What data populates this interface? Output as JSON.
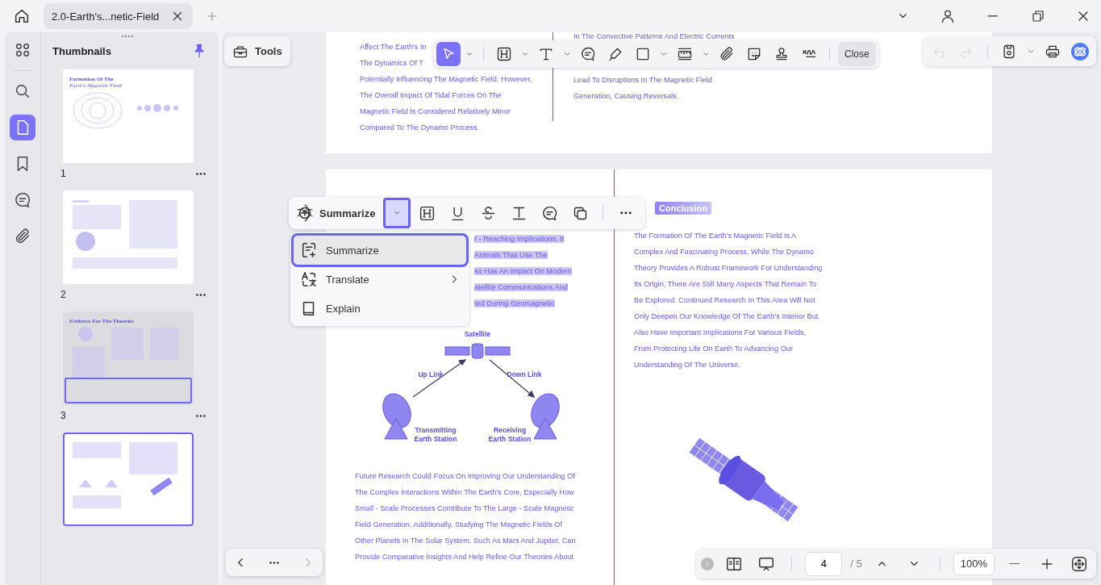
{
  "tab_bar": {
    "tabs": [
      {
        "title": "2.0-Earth's...netic-Field",
        "selected": true
      }
    ]
  },
  "sidebar": {
    "rail": [
      {
        "kind": "apps",
        "selected": false
      },
      {
        "kind": "search",
        "selected": false
      },
      {
        "kind": "page",
        "selected": true
      },
      {
        "kind": "bookmark",
        "selected": false
      },
      {
        "kind": "comment",
        "selected": false
      },
      {
        "kind": "attachment",
        "selected": false
      }
    ],
    "panel": {
      "title": "Thumbnails",
      "pinned": true
    },
    "thumbnails": [
      {
        "number": "1",
        "kind": "title",
        "title": "Formation Of The",
        "subtitle": "Earth's Magnetic Field",
        "selected": false,
        "in_view": false
      },
      {
        "number": "2",
        "kind": "columns",
        "selected": false,
        "in_view": false
      },
      {
        "number": "3",
        "kind": "evidence",
        "title": "*Evidence* For The Theories",
        "selected": false,
        "in_view": true
      },
      {
        "kind": "diagram",
        "selected": true,
        "in_view": false
      }
    ]
  },
  "toolbar": {
    "tools_label": "Tools",
    "items": [
      {
        "kind": "select",
        "selected": true,
        "has_menu": true
      },
      {
        "kind": "highlight",
        "selected": false,
        "has_menu": true
      },
      {
        "kind": "text",
        "selected": false,
        "has_menu": true
      },
      {
        "kind": "comment",
        "selected": false,
        "has_menu": false
      },
      {
        "kind": "pen",
        "selected": false,
        "has_menu": false
      },
      {
        "kind": "shape",
        "selected": false,
        "has_menu": true
      },
      {
        "kind": "measure",
        "selected": false,
        "has_menu": true
      },
      {
        "kind": "attachment",
        "selected": false,
        "has_menu": false
      },
      {
        "kind": "sticker",
        "selected": false,
        "has_menu": false
      },
      {
        "kind": "stamp",
        "selected": false,
        "has_menu": false
      },
      {
        "kind": "signature",
        "selected": false,
        "has_menu": false
      }
    ],
    "close_label": "Close"
  },
  "quick_actions": [
    {
      "kind": "undo",
      "disabled": true
    },
    {
      "kind": "redo",
      "disabled": true
    },
    {
      "kind": "save",
      "disabled": false
    },
    {
      "kind": "print",
      "disabled": false
    },
    {
      "kind": "ai",
      "disabled": false
    }
  ],
  "page_upper": {
    "left_lines": [
      "Affect The Earth's In",
      "The Dynamics Of T",
      "Potentially Influencing The Magnetic Field. However,",
      "The Overall Impact Of Tidal Forces On The",
      "Magnetic Field Is Considered Relatively Minor",
      "Compared To The Dynamo Process."
    ],
    "right_top": "In The Convective Patterns And Electric Currents",
    "right_lines": [
      "Lead To Disruptions In The Magnetic Field",
      "Generation, Causing Reversals."
    ]
  },
  "page_lower": {
    "selected_lines": [
      "r - Reaching Implications. It",
      "Animals That Use The",
      "so Has An Impact On Modern",
      "atellite Communications And",
      "ted During Geomagnetic"
    ],
    "diagram": {
      "satellite": "Satellite",
      "up_link": "Up Link",
      "down_link": "Down Link",
      "transmitter": [
        "Transmitting",
        "Earth Station"
      ],
      "receiver": [
        "Receiving",
        "Earth Station"
      ]
    },
    "left_lines": [
      "Future Research Could Focus On Improving Our Understanding Of",
      "The Complex Interactions Within The Earth's Core, Especially How",
      "Small - Scale Processes Contribute To The Large - Scale Magnetic",
      "Field Generation. Additionally, Studying The Magnetic Fields Of",
      "Other Planets In The Solar System, Such As Mars And Jupiter, Can",
      "Provide Comparative Insights And Help Refine Our Theories About"
    ],
    "heading": "Conclusion",
    "right_lines": [
      "The Formation Of The Earth's Magnetic Field Is A",
      "Complex And Fascinating Process. While The Dynamo",
      "Theory Provides A Robust Framework For Understanding",
      "Its Origin, There Are Still Many Aspects That Remain To",
      "Be Explored. Continued Research In This Area Will Not",
      "Only Deepen Our Knowledge Of The Earth's Interior But",
      "Also Have Important Implications For Various Fields,",
      "From Protecting Life On Earth To Advancing Our",
      "Understanding Of The Universe."
    ]
  },
  "selection_toolbar": {
    "action": "Summarize",
    "menu_open": true,
    "tools": [
      {
        "kind": "highlight"
      },
      {
        "kind": "underline"
      },
      {
        "kind": "strikethrough"
      },
      {
        "kind": "squiggly"
      },
      {
        "kind": "comment"
      },
      {
        "kind": "copy"
      },
      {
        "kind": "more"
      }
    ]
  },
  "action_menu": [
    {
      "label": "Summarize",
      "kind": "summarize",
      "selected": true,
      "submenu": false
    },
    {
      "label": "Translate",
      "kind": "translate",
      "selected": false,
      "submenu": true
    },
    {
      "label": "Explain",
      "kind": "explain",
      "selected": false,
      "submenu": false
    }
  ],
  "page_nav": {
    "next_disabled": true
  },
  "status_bar": {
    "page": "4",
    "total": "/ 5",
    "zoom": "100%"
  }
}
